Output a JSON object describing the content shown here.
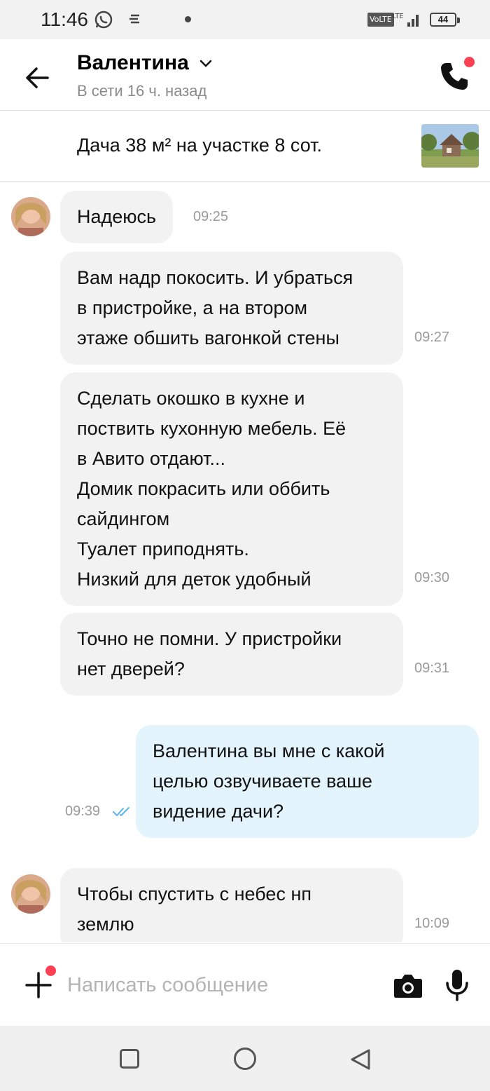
{
  "status_bar": {
    "time": "11:46",
    "network": "VoLTE",
    "signal_label": "LTE",
    "battery": "44",
    "icons": [
      "whatsapp-icon",
      "notes-icon",
      "dot-icon",
      "volte-icon",
      "signal-icon",
      "battery-icon"
    ]
  },
  "header": {
    "back_icon": "arrow-left-icon",
    "contact_name": "Валентина",
    "contact_status": "В сети 16 ч. назад",
    "call_icon": "phone-icon"
  },
  "listing": {
    "title": "Дача 38 м² на участке 8 сот."
  },
  "messages": [
    {
      "direction": "in",
      "text": "Надеюсь",
      "time": "09:25"
    },
    {
      "direction": "in",
      "text": "Вам надр покосить. И убраться\nв пристройке, а на втором\nэтаже обшить вагонкой стены",
      "time": "09:27"
    },
    {
      "direction": "in",
      "text": "Сделать окошко в кухне и\nпоствить кухонную мебель. Её\nв Авито отдают...\nДомик покрасить или оббить\nсайдингом\nТуалет приподнять.\nНизкий для деток удобный",
      "time": "09:30"
    },
    {
      "direction": "in",
      "text": "Точно не помни. У пристройки\nнет дверей?",
      "time": "09:31"
    },
    {
      "direction": "out",
      "text": "Валентина вы мне с какой\nцелью озвучиваете ваше\nвидение дачи?",
      "time": "09:39",
      "status": "read"
    },
    {
      "direction": "in",
      "text": "Чтобы спустить с небес нп\nземлю",
      "time": "10:09"
    }
  ],
  "composer": {
    "placeholder": "Написать сообщение",
    "value": ""
  },
  "colors": {
    "incoming_bubble": "#f2f2f2",
    "outgoing_bubble": "#e3f4fd",
    "notification_dot": "#ff4053",
    "read_ticks": "#5ab4e8"
  }
}
